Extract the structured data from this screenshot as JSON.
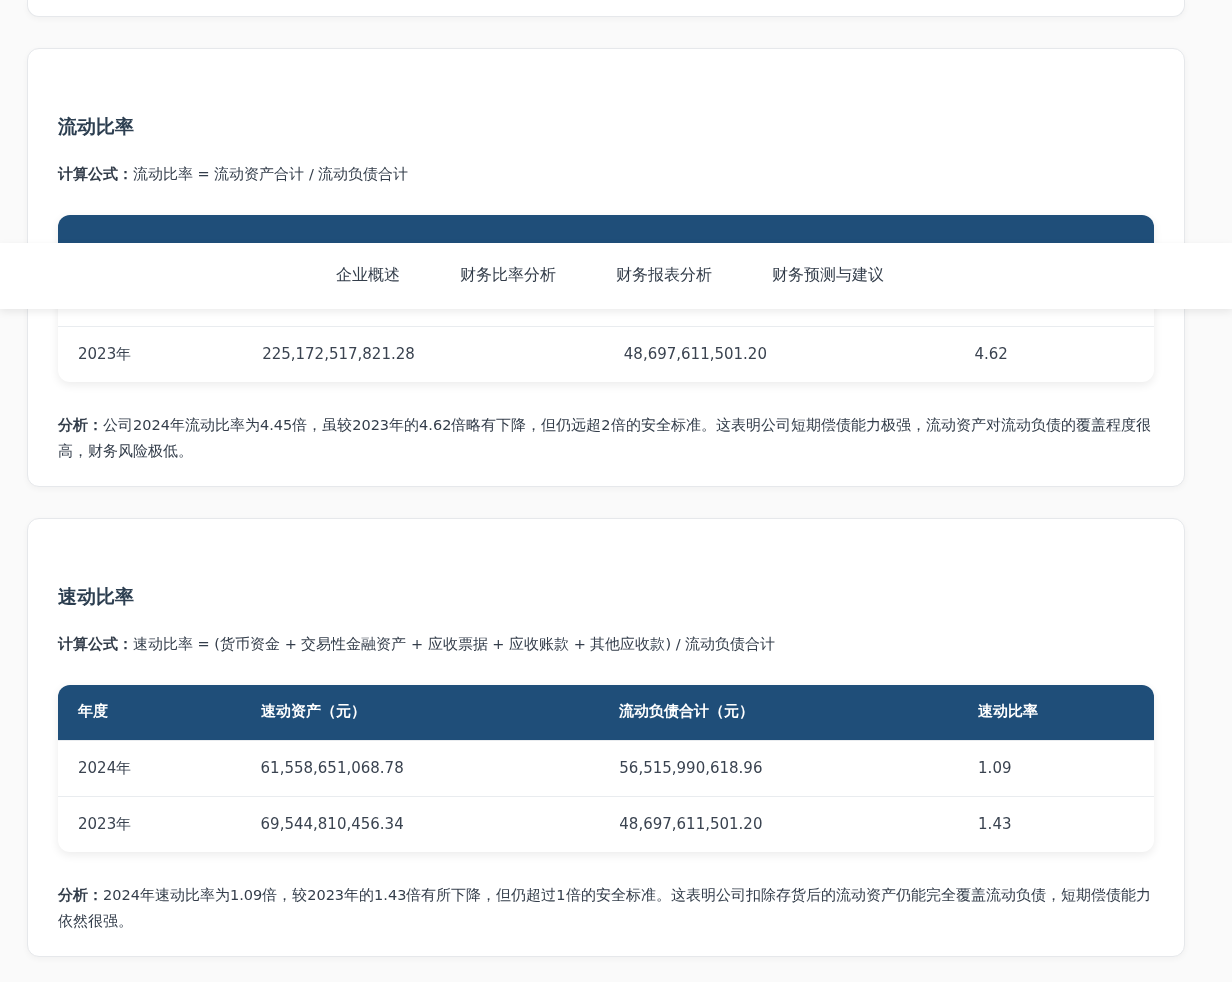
{
  "nav": {
    "items": [
      {
        "label": "企业概述",
        "selected": false
      },
      {
        "label": "财务比率分析",
        "selected": false
      },
      {
        "label": "财务报表分析",
        "selected": false
      },
      {
        "label": "财务预测与建议",
        "selected": false
      }
    ]
  },
  "sections": [
    {
      "title": "流动比率",
      "formula_label": "计算公式：",
      "formula": "流动比率 = 流动资产合计 / 流动负债合计",
      "rows": [
        {
          "cells": [
            "2023年",
            "225,172,517,821.28",
            "48,697,611,501.20",
            "4.62"
          ]
        }
      ],
      "analysis": "**分析：**公司2024年流动比率为4.45倍，虽较2023年的4.62倍略有下降，但仍远超2倍的安全标准。这表明公司短期偿债能力极强，流动资产对流动负债的覆盖程度很高，财务风险极低。"
    },
    {
      "title": "速动比率",
      "formula_label": "计算公式：",
      "formula": "速动比率 = (货币资金 + 交易性金融资产 + 应收票据 + 应收账款 + 其他应收款) / 流动负债合计",
      "columns": [
        "年度",
        "速动资产（元）",
        "流动负债合计（元）",
        "速动比率"
      ],
      "rows": [
        {
          "cells": [
            "2024年",
            "61,558,651,068.78",
            "56,515,990,618.96",
            "1.09"
          ]
        },
        {
          "cells": [
            "2023年",
            "69,544,810,456.34",
            "48,697,611,501.20",
            "1.43"
          ]
        }
      ],
      "analysis": "**分析：**2024年速动比率为1.09倍，较2023年的1.43倍有所下降，但仍超过1倍的安全标准。这表明公司扣除存货后的流动资产仍能完全覆盖流动负债，短期偿债能力依然很强。"
    }
  ]
}
